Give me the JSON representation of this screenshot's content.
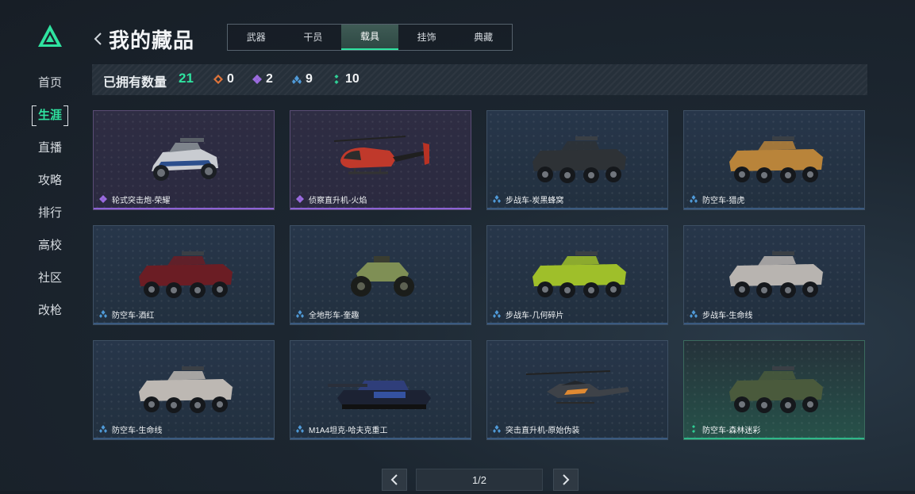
{
  "nav": {
    "items": [
      {
        "label": "首页"
      },
      {
        "label": "生涯"
      },
      {
        "label": "直播"
      },
      {
        "label": "攻略"
      },
      {
        "label": "排行"
      },
      {
        "label": "高校"
      },
      {
        "label": "社区"
      },
      {
        "label": "改枪"
      }
    ],
    "active_index": 1
  },
  "header": {
    "title": "我的藏品",
    "back_icon": "chevron-left-icon"
  },
  "tabs": [
    {
      "label": "武器"
    },
    {
      "label": "干员"
    },
    {
      "label": "载具"
    },
    {
      "label": "挂饰"
    },
    {
      "label": "典藏"
    }
  ],
  "active_tab_index": 2,
  "stats": {
    "label": "已拥有数量",
    "total": "21",
    "rarities": [
      {
        "icon": "orange-diamond-icon",
        "count": "0",
        "color": "#e0743a"
      },
      {
        "icon": "purple-diamond-icon",
        "count": "2",
        "color": "#9b6be0"
      },
      {
        "icon": "blue-diamond-icon",
        "count": "9",
        "color": "#4f9ad8"
      },
      {
        "icon": "green-dots-icon",
        "count": "10",
        "color": "#2fcf95"
      }
    ]
  },
  "items": [
    {
      "name": "轮式突击炮-荣耀",
      "rarity": "purple",
      "vehicle": "buggy-icon"
    },
    {
      "name": "侦察直升机-火焰",
      "rarity": "purple",
      "vehicle": "helicopter-icon"
    },
    {
      "name": "步战车-炭黑蜂窝",
      "rarity": "blue",
      "vehicle": "ifv-icon"
    },
    {
      "name": "防空车-猎虎",
      "rarity": "blue",
      "vehicle": "aa-vehicle-icon"
    },
    {
      "name": "防空车-酒红",
      "rarity": "blue",
      "vehicle": "aa-vehicle-icon"
    },
    {
      "name": "全地形车-奎趣",
      "rarity": "blue",
      "vehicle": "atv-icon"
    },
    {
      "name": "步战车-几何碎片",
      "rarity": "blue",
      "vehicle": "ifv-icon"
    },
    {
      "name": "步战车-生命线",
      "rarity": "blue",
      "vehicle": "ifv-icon"
    },
    {
      "name": "防空车-生命线",
      "rarity": "blue",
      "vehicle": "aa-vehicle-icon"
    },
    {
      "name": "M1A4坦克-哈夫克重工",
      "rarity": "blue",
      "vehicle": "tank-icon"
    },
    {
      "name": "突击直升机-原始伪装",
      "rarity": "blue",
      "vehicle": "attack-helicopter-icon"
    },
    {
      "name": "防空车-森林迷彩",
      "rarity": "green",
      "vehicle": "aa-vehicle-icon"
    }
  ],
  "pagination": {
    "text": "1/2"
  },
  "colors": {
    "accent": "#2fe3a0",
    "purple": "#8d63d6",
    "blue": "#4f9ad8",
    "green": "#2fcf95"
  }
}
